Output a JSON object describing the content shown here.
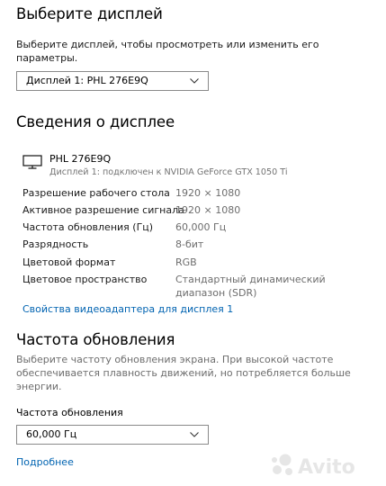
{
  "select_display": {
    "title": "Выберите дисплей",
    "description": "Выберите дисплей, чтобы просмотреть или изменить его параметры.",
    "description_line1": "Выберите дисплей, чтобы просмотреть или изменить его",
    "description_line2": "параметры.",
    "dropdown_value": "Дисплей 1: PHL 276E9Q"
  },
  "display_info": {
    "title": "Сведения о дисплее",
    "monitor_icon": "monitor-icon",
    "monitor_name": "PHL 276E9Q",
    "monitor_connection": "Дисплей 1: подключен к NVIDIA GeForce GTX 1050 Ti",
    "rows": [
      {
        "label": "Разрешение рабочего стола",
        "value": "1920 × 1080"
      },
      {
        "label": "Активное разрешение сигнала",
        "value": "1920 × 1080"
      },
      {
        "label": "Частота обновления (Гц)",
        "value": "60,000 Гц"
      },
      {
        "label": "Разрядность",
        "value": "8-бит"
      },
      {
        "label": "Цветовой формат",
        "value": "RGB"
      },
      {
        "label": "Цветовое пространство",
        "value_line1": "Стандартный динамический",
        "value_line2": "диапазон (SDR)"
      }
    ],
    "adapter_link": "Свойства видеоадаптера для дисплея 1"
  },
  "refresh_rate": {
    "title": "Частота обновления",
    "description_line1": "Выберите частоту обновления экрана. При высокой частоте",
    "description_line2": "обеспечивается плавность движений, но потребляется больше",
    "description_line3": "энергии.",
    "field_label": "Частота обновления",
    "dropdown_value": "60,000 Гц",
    "more_link": "Подробнее"
  },
  "watermark": {
    "text": "Avito"
  },
  "colors": {
    "link": "#0063b1",
    "secondary_text": "#6d6d6d",
    "border": "#8a8a8a"
  }
}
